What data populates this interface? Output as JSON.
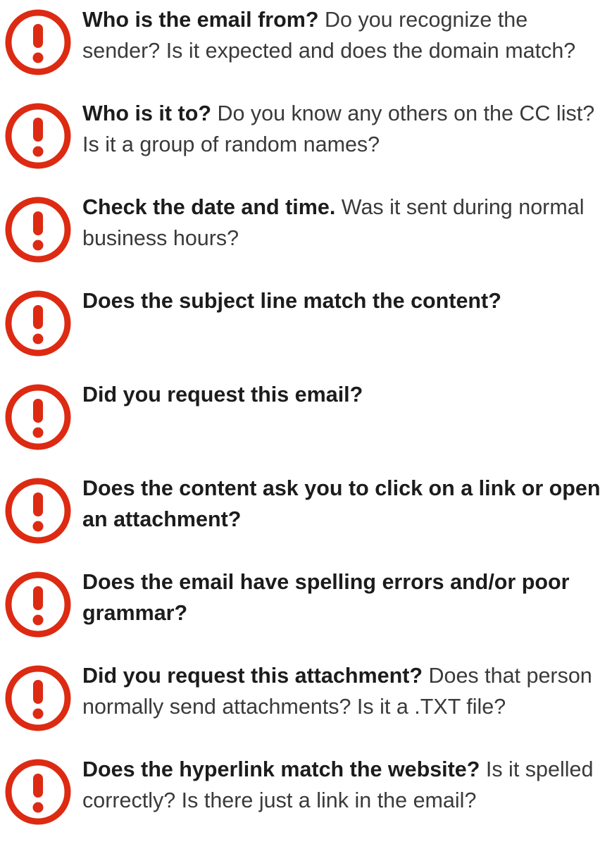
{
  "accent_color": "#dd2a12",
  "icon": "exclamation-circle-icon",
  "items": [
    {
      "bold": "Who is the email from?",
      "rest": " Do you recognize the sender? Is it expected and does the domain match?"
    },
    {
      "bold": "Who is it to?",
      "rest": " Do you know any others on the CC list? Is it a group of random names?"
    },
    {
      "bold": "Check the date and time.",
      "rest": " Was it sent during normal business hours?"
    },
    {
      "bold": "Does the subject line match the content?",
      "rest": ""
    },
    {
      "bold": "Did you request this email?",
      "rest": ""
    },
    {
      "bold": "Does the content ask you to click on a link or open an attachment?",
      "rest": ""
    },
    {
      "bold": "Does the email have spelling errors and/or poor grammar?",
      "rest": ""
    },
    {
      "bold": "Did you request this attachment?",
      "rest": " Does that person normally send attachments? Is it a .TXT file?"
    },
    {
      "bold": "Does the hyperlink match the website?",
      "rest": " Is it spelled correctly? Is there just a link in the email?"
    }
  ]
}
